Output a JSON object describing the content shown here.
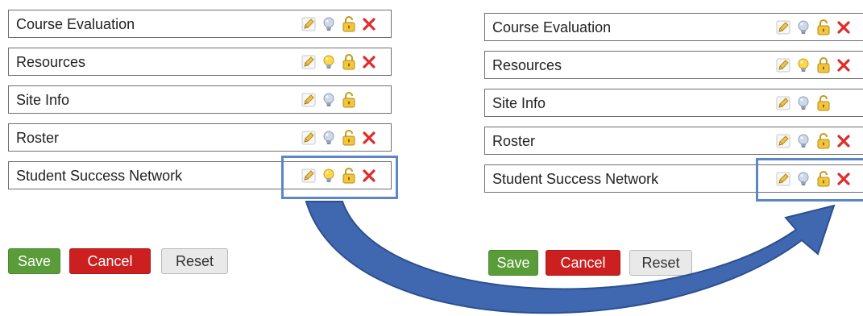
{
  "colors": {
    "arrow": "#3f68b0",
    "highlight": "#5b86c8",
    "save": "#5a9c3a",
    "cancel": "#cc1f1f",
    "reset": "#e9e9e9"
  },
  "left_panel": {
    "rows": [
      {
        "label": "Course Evaluation",
        "icons": [
          "pencil-icon",
          "bulb-off-icon",
          "lock-open-icon",
          "delete-x-icon"
        ]
      },
      {
        "label": "Resources",
        "icons": [
          "pencil-icon",
          "bulb-on-icon",
          "lock-closed-icon",
          "delete-x-icon"
        ]
      },
      {
        "label": "Site Info",
        "icons": [
          "pencil-icon",
          "bulb-off-icon",
          "lock-open-icon"
        ]
      },
      {
        "label": "Roster",
        "icons": [
          "pencil-icon",
          "bulb-off-icon",
          "lock-open-icon",
          "delete-x-icon"
        ]
      },
      {
        "label": "Student Success Network",
        "icons": [
          "pencil-icon",
          "bulb-on-icon",
          "lock-open-icon",
          "delete-x-icon"
        ]
      }
    ],
    "buttons": {
      "save": "Save",
      "cancel": "Cancel",
      "reset": "Reset"
    }
  },
  "right_panel": {
    "rows": [
      {
        "label": "Course Evaluation",
        "icons": [
          "pencil-icon",
          "bulb-off-icon",
          "lock-open-icon",
          "delete-x-icon"
        ]
      },
      {
        "label": "Resources",
        "icons": [
          "pencil-icon",
          "bulb-on-icon",
          "lock-closed-icon",
          "delete-x-icon"
        ]
      },
      {
        "label": "Site Info",
        "icons": [
          "pencil-icon",
          "bulb-off-icon",
          "lock-open-icon"
        ]
      },
      {
        "label": "Roster",
        "icons": [
          "pencil-icon",
          "bulb-off-icon",
          "lock-open-icon",
          "delete-x-icon"
        ]
      },
      {
        "label": "Student Success Network",
        "icons": [
          "pencil-icon",
          "bulb-off-icon",
          "lock-open-icon",
          "delete-x-icon"
        ]
      }
    ],
    "buttons": {
      "save": "Save",
      "cancel": "Cancel",
      "reset": "Reset"
    }
  }
}
